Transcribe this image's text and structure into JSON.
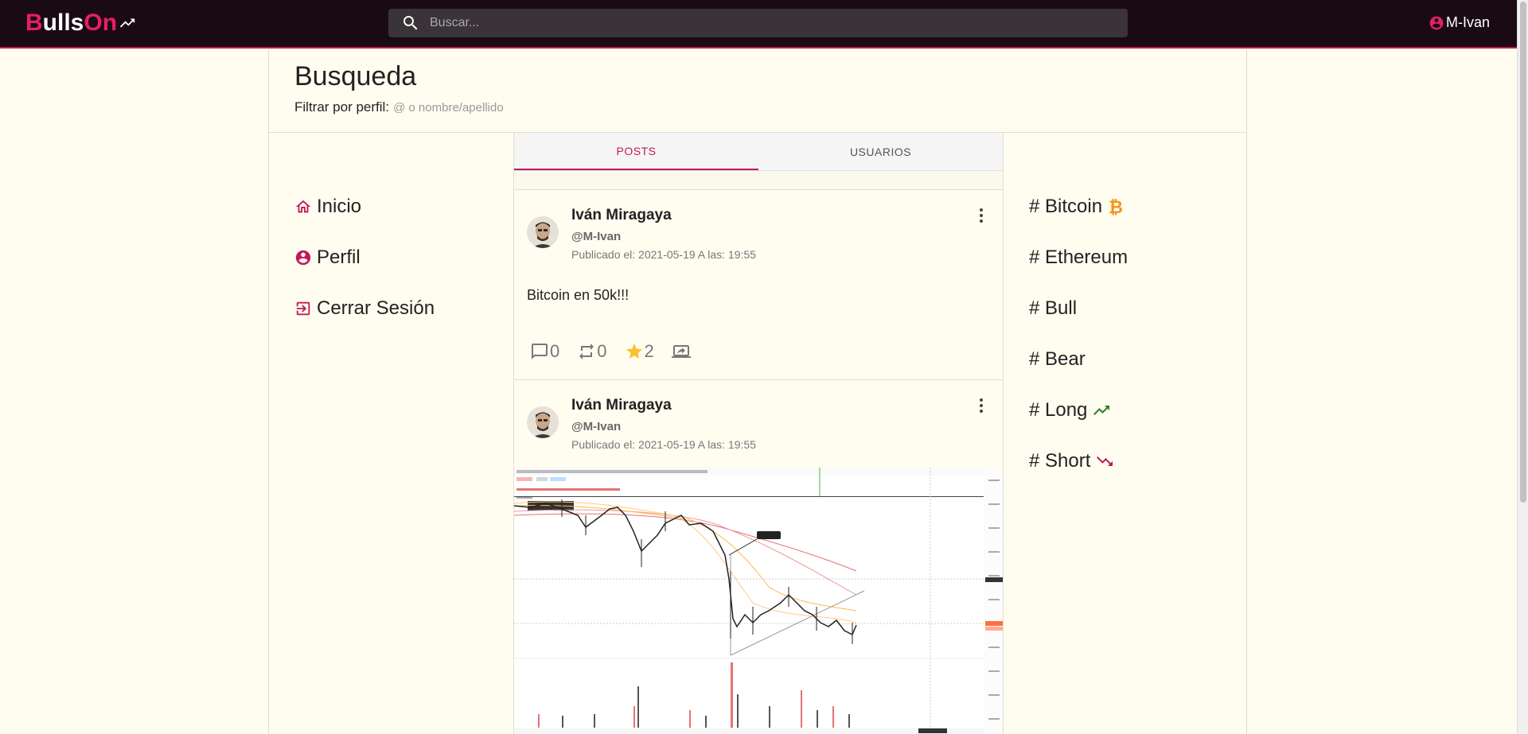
{
  "app": {
    "logo_prefix": "B",
    "logo_main": "ulls",
    "logo_suffix": "On",
    "search_placeholder": "Buscar...",
    "username": "M-Ivan"
  },
  "page": {
    "title": "Busqueda",
    "filter_label": "Filtrar por perfil:",
    "filter_placeholder": "@ o nombre/apellido"
  },
  "left_nav": [
    {
      "label": "Inicio",
      "icon": "home-icon"
    },
    {
      "label": "Perfil",
      "icon": "account-circle-icon"
    },
    {
      "label": "Cerrar Sesión",
      "icon": "logout-icon"
    }
  ],
  "tabs": [
    {
      "label": "POSTS",
      "active": true
    },
    {
      "label": "USUARIOS",
      "active": false
    }
  ],
  "posts": [
    {
      "name": "Iván Miragaya",
      "handle": "@M-Ivan",
      "date": "Publicado el: 2021-05-19 A las: 19:55",
      "body": "Bitcoin en 50k!!!",
      "comments": "0",
      "reposts": "0",
      "stars": "2"
    },
    {
      "name": "Iván Miragaya",
      "handle": "@M-Ivan",
      "date": "Publicado el: 2021-05-19 A las: 19:55"
    }
  ],
  "right_tags": [
    {
      "label": "# Bitcoin",
      "icon": "bitcoin-icon",
      "color": "#f7931a"
    },
    {
      "label": "# Ethereum",
      "icon": "",
      "color": ""
    },
    {
      "label": "# Bull",
      "icon": "",
      "color": ""
    },
    {
      "label": "# Bear",
      "icon": "",
      "color": ""
    },
    {
      "label": "# Long",
      "icon": "trending-up-icon",
      "color": "#2e7d32"
    },
    {
      "label": "# Short",
      "icon": "trending-down-icon",
      "color": "#c2185b"
    }
  ],
  "colors": {
    "accent": "#c2185b",
    "topbar": "#1a0a14",
    "background": "#fffdf0",
    "star": "#fbc02d"
  }
}
